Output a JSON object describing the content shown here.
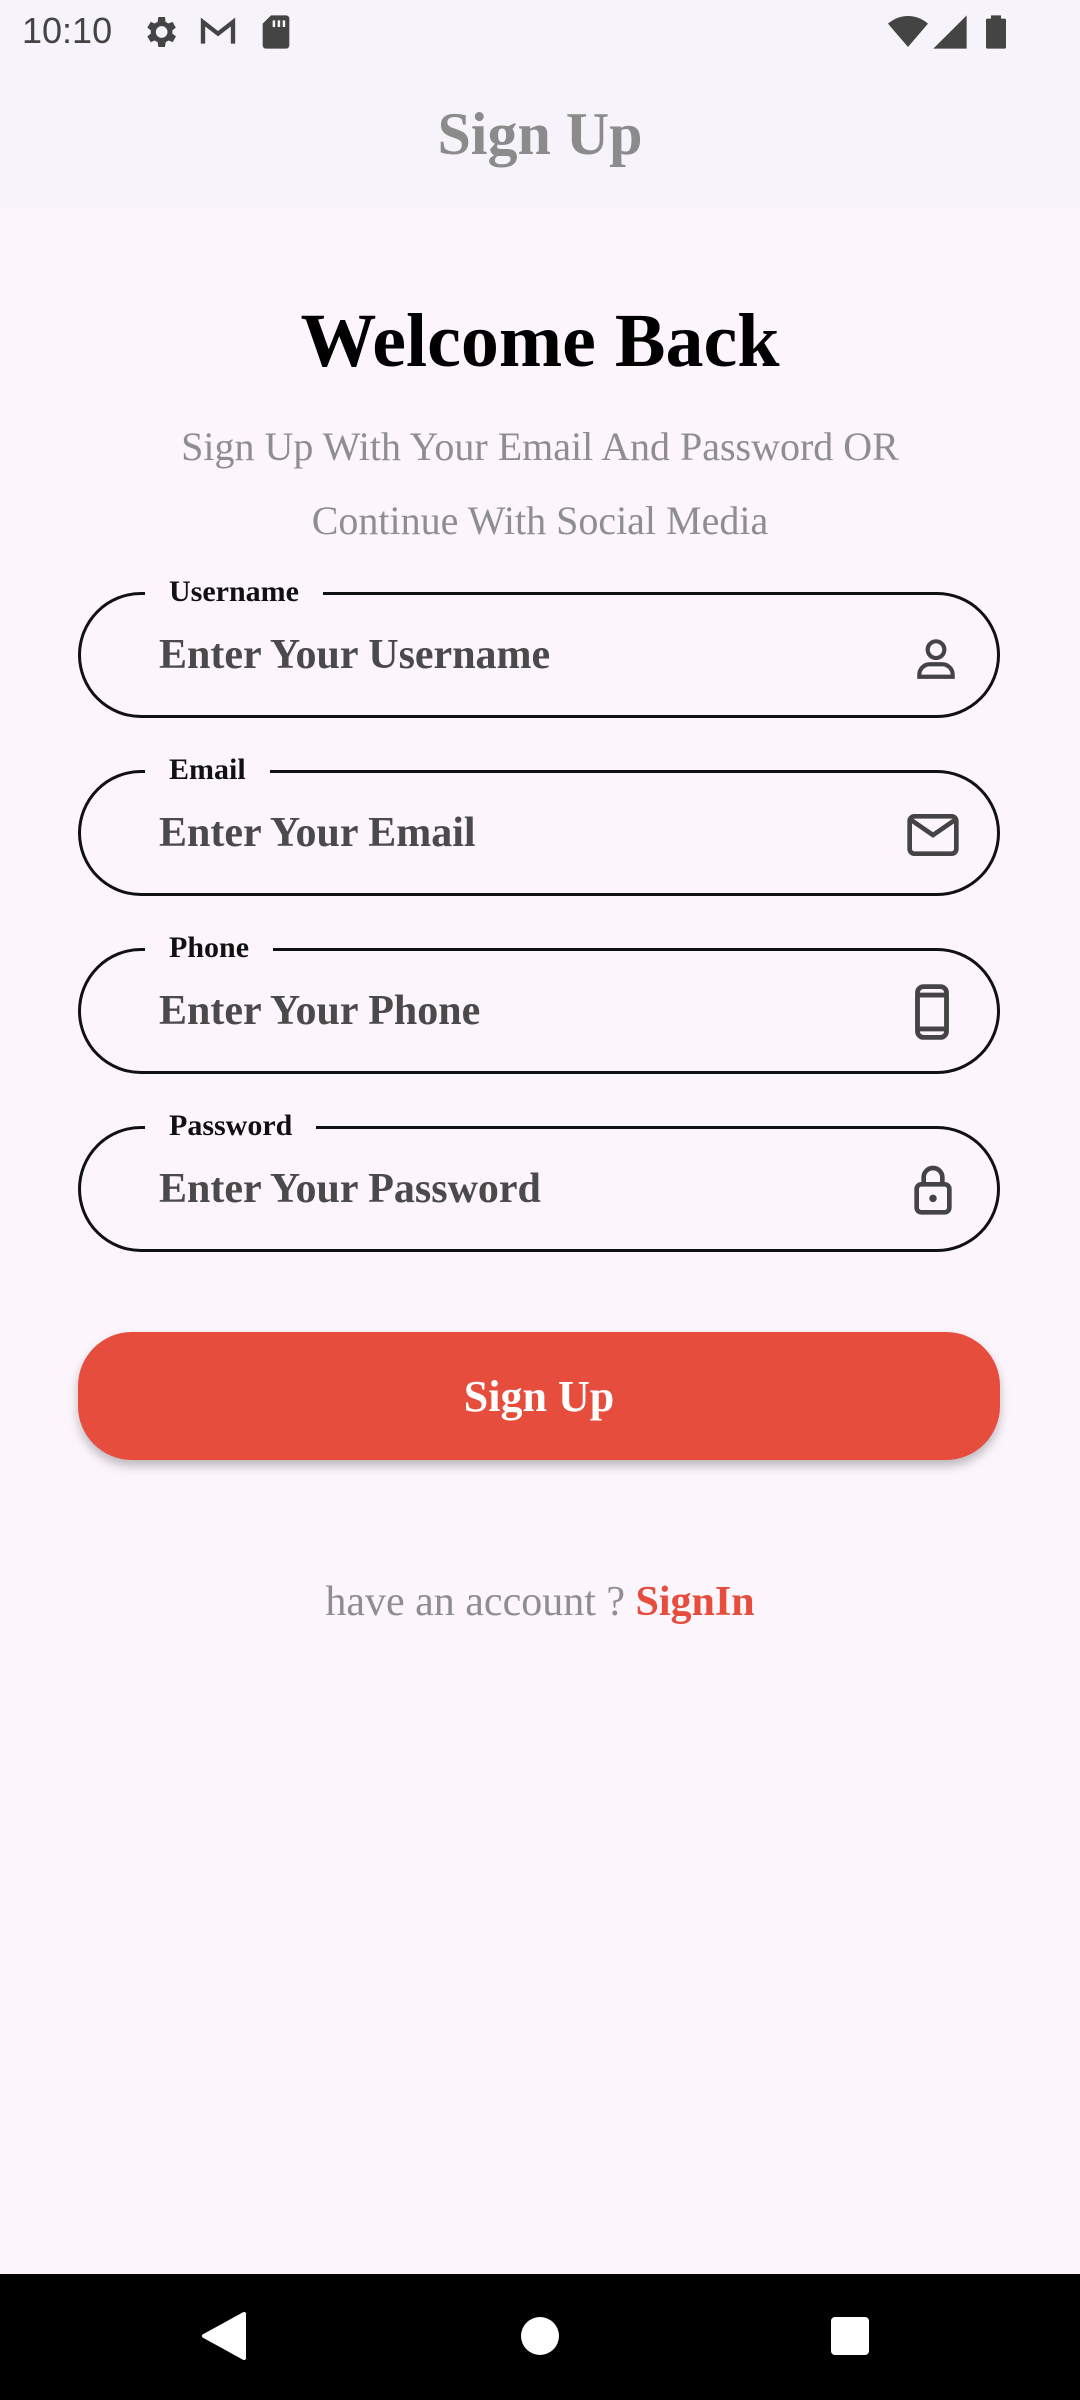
{
  "status_bar": {
    "time": "10:10",
    "left_icons": [
      "gear-icon",
      "gmail-icon",
      "sd-card-icon"
    ],
    "right_icons": [
      "wifi-icon",
      "signal-icon",
      "battery-icon"
    ]
  },
  "app_bar": {
    "title": "Sign Up"
  },
  "welcome": {
    "title": "Welcome Back",
    "subtitle": "Sign Up With Your Email And Password OR Continue With Social Media"
  },
  "fields": [
    {
      "label": "Username",
      "placeholder": "Enter Your Username",
      "icon": "person-icon"
    },
    {
      "label": "Email",
      "placeholder": "Enter Your Email",
      "icon": "mail-icon"
    },
    {
      "label": "Phone",
      "placeholder": "Enter Your Phone",
      "icon": "phone-icon"
    },
    {
      "label": "Password",
      "placeholder": "Enter Your Password",
      "icon": "lock-icon"
    }
  ],
  "signup_button": {
    "label": "Sign Up"
  },
  "signin": {
    "prompt": "have an account ? ",
    "link": "SignIn"
  },
  "colors": {
    "accent": "#e64d3d",
    "background": "#fcf6fc",
    "app_bar": "#f6f4fa",
    "subtitle": "#8e8e8e"
  },
  "nav_bar": {
    "icons": [
      "back-icon",
      "home-icon",
      "recents-icon"
    ]
  }
}
